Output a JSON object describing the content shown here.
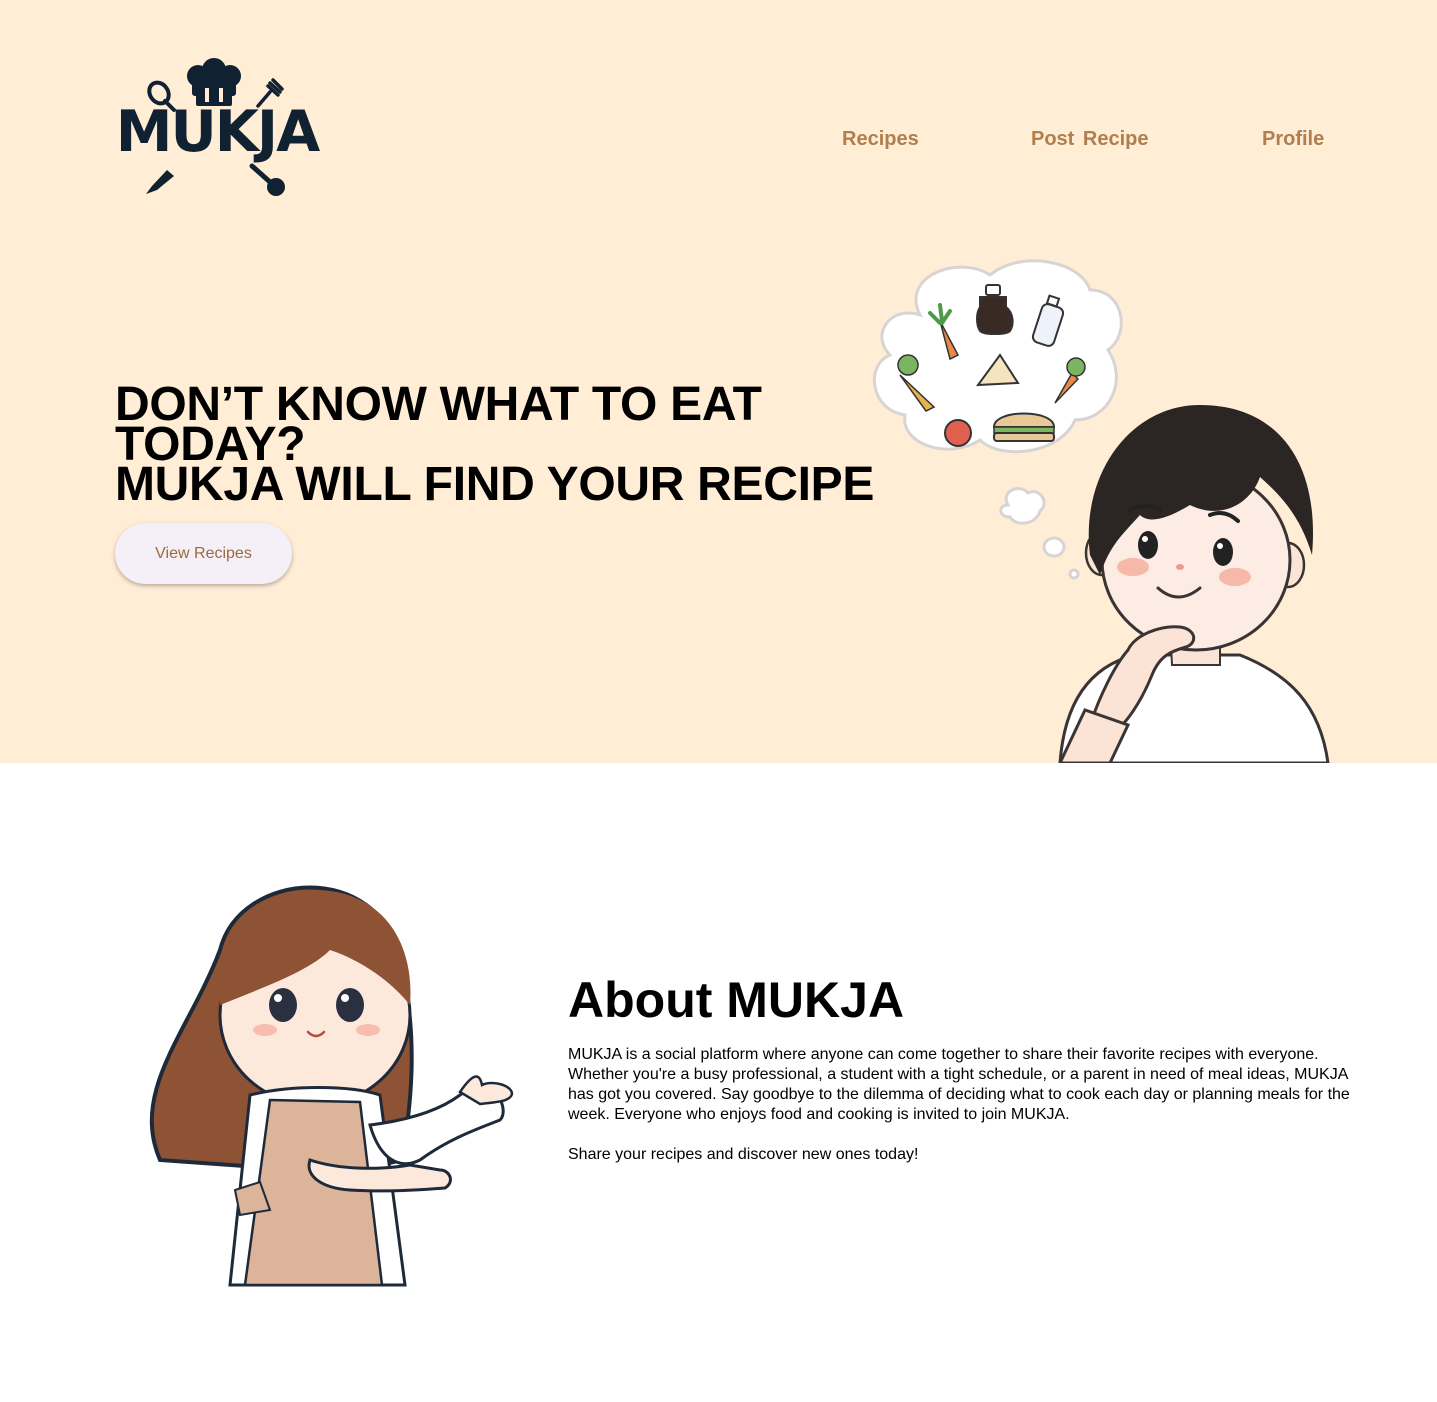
{
  "brand": {
    "logo_text": "MUKJA"
  },
  "nav": {
    "items": [
      {
        "label": "Recipes"
      },
      {
        "label": "Post  Recipe"
      },
      {
        "label": "Profile"
      }
    ]
  },
  "hero": {
    "headline_lines": [
      "DON’T KNOW WHAT TO EAT",
      "TODAY?",
      "MUKJA WILL FIND YOUR RECIPE"
    ],
    "cta_label": "View Recipes"
  },
  "about": {
    "title": "About MUKJA",
    "paragraphs": [
      "MUKJA is a social platform where anyone can come together to share their favorite recipes with everyone. Whether you're a busy professional, a student with a tight schedule, or a parent in need of meal ideas, MUKJA has got you covered. Say goodbye to the dilemma of deciding what to cook each day or planning meals for the week. Everyone who enjoys food and cooking is invited to join MUKJA.",
      "Share your recipes and discover new ones today!"
    ]
  },
  "colors": {
    "hero_bg": "#ffedd6",
    "nav_text": "#b07e4f",
    "logo": "#102231",
    "button_bg": "#f5eff7",
    "button_text": "#9a6b3f"
  }
}
